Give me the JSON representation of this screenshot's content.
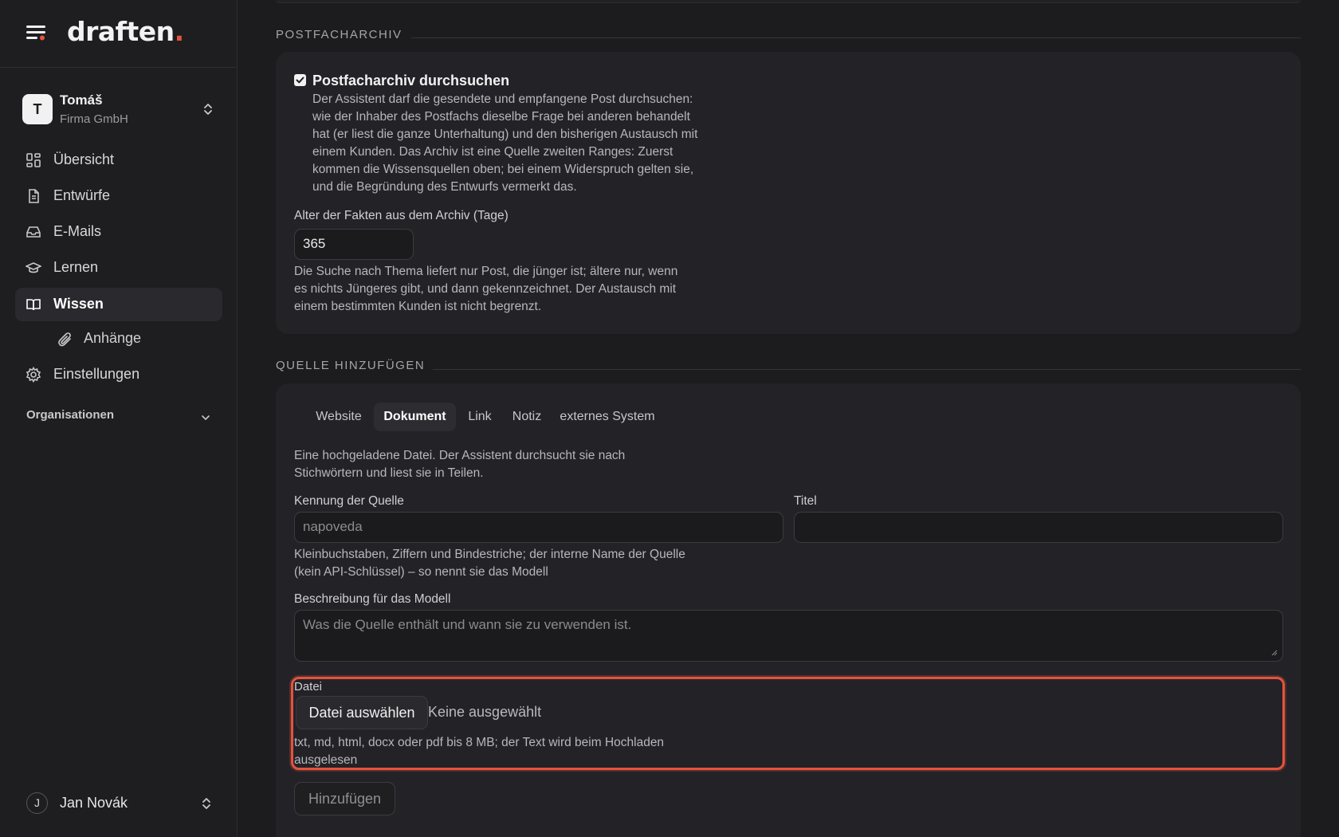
{
  "app": {
    "logo_text": "draften",
    "logo_dot": "."
  },
  "account": {
    "avatar_letter": "T",
    "name": "Tomáš",
    "org": "Firma GmbH"
  },
  "nav": [
    {
      "label": "Übersicht",
      "icon": "dashboard-icon"
    },
    {
      "label": "Entwürfe",
      "icon": "document-icon"
    },
    {
      "label": "E-Mails",
      "icon": "inbox-icon"
    },
    {
      "label": "Lernen",
      "icon": "graduation-cap-icon"
    },
    {
      "label": "Wissen",
      "icon": "book-icon",
      "active": true
    },
    {
      "label": "Anhänge",
      "icon": "paperclip-icon",
      "sub": true
    },
    {
      "label": "Einstellungen",
      "icon": "gear-icon"
    }
  ],
  "organisations_label": "Organisationen",
  "user": {
    "avatar_letter": "J",
    "name": "Jan Novák"
  },
  "archive": {
    "section_title": "POSTFACHARCHIV",
    "checkbox_label": "Postfacharchiv durchsuchen",
    "checkbox_checked": true,
    "description": [
      "Der Assistent darf die gesendete und empfangene Post durchsuchen:",
      "wie der Inhaber des Postfachs dieselbe Frage bei anderen behandelt",
      "hat (er liest die ganze Unterhaltung) und den bisherigen Austausch mit",
      "einem Kunden. Das Archiv ist eine Quelle zweiten Ranges: Zuerst",
      "kommen die Wissensquellen oben; bei einem Widerspruch gelten sie,",
      "und die Begründung des Entwurfs vermerkt das."
    ],
    "age_label": "Alter der Fakten aus dem Archiv (Tage)",
    "age_value": "365",
    "age_help": [
      "Die Suche nach Thema liefert nur Post, die jünger ist; ältere nur, wenn",
      "es nichts Jüngeres gibt, und dann gekennzeichnet. Der Austausch mit",
      "einem bestimmten Kunden ist nicht begrenzt."
    ]
  },
  "add_source": {
    "section_title": "QUELLE HINZUFÜGEN",
    "tabs": [
      "Website",
      "Dokument",
      "Link",
      "Notiz",
      "externes System"
    ],
    "active_tab": "Dokument",
    "intro": [
      "Eine hochgeladene Datei. Der Assistent durchsucht sie nach",
      "Stichwörtern und liest sie in Teilen."
    ],
    "id_label": "Kennung der Quelle",
    "id_placeholder": "napoveda",
    "title_label": "Titel",
    "title_value": "",
    "id_help": [
      "Kleinbuchstaben, Ziffern und Bindestriche; der interne Name der Quelle",
      "(kein API-Schlüssel) – so nennt sie das Modell"
    ],
    "desc_label": "Beschreibung für das Modell",
    "desc_placeholder": "Was die Quelle enthält und wann sie zu verwenden ist.",
    "file_label": "Datei",
    "file_button": "Datei auswählen",
    "file_none": "Keine ausgewählt",
    "file_help": [
      "txt, md, html, docx oder pdf bis 8 MB; der Text wird beim Hochladen",
      "ausgelesen"
    ],
    "add_button": "Hinzufügen"
  },
  "colors": {
    "accent": "#e5533d",
    "background": "#1c1c1f",
    "card": "#232327"
  }
}
